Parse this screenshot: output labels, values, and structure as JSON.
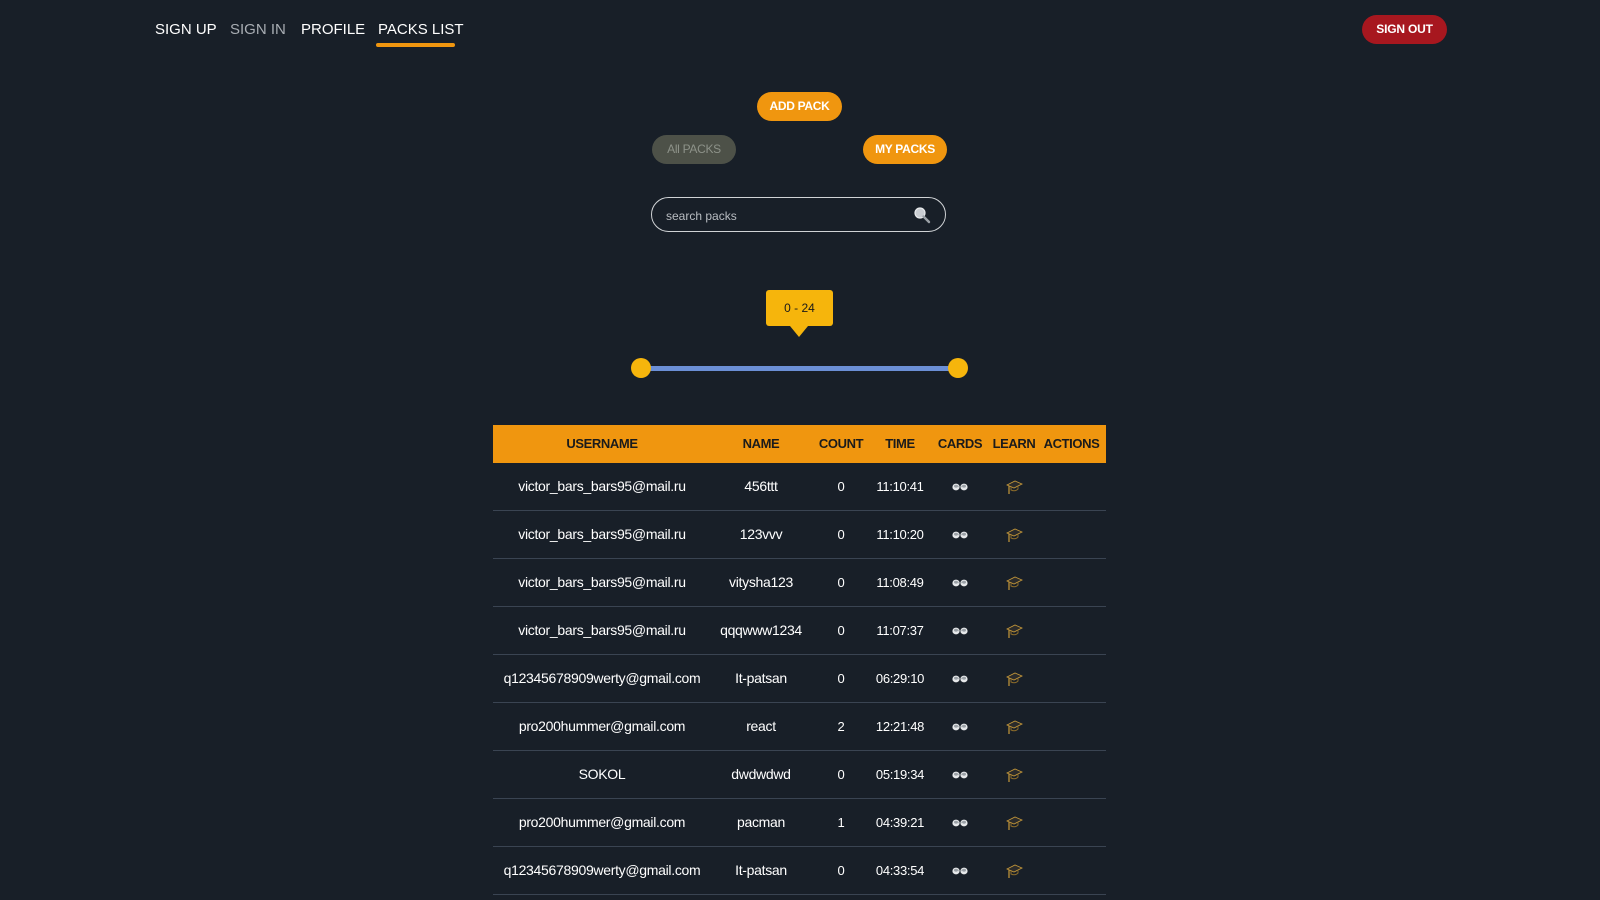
{
  "nav": {
    "links": [
      "SIGN UP",
      "SIGN IN",
      "PROFILE",
      "PACKS LIST"
    ],
    "active": "PACKS LIST",
    "signout_label": "SIGN OUT"
  },
  "controls": {
    "add_pack_label": "ADD PACK",
    "all_packs_label": "All PACKS",
    "my_packs_label": "MY PACKS",
    "search_placeholder": "search packs",
    "search_value": "",
    "range_label": "0 - 24",
    "range_min": 0,
    "range_max": 24
  },
  "table": {
    "headers": [
      "USERNAME",
      "NAME",
      "COUNT",
      "TIME",
      "CARDS",
      "LEARN",
      "ACTIONS"
    ],
    "rows": [
      {
        "username": "victor_bars_bars95@mail.ru",
        "name": "456ttt",
        "count": "0",
        "time": "11:10:41"
      },
      {
        "username": "victor_bars_bars95@mail.ru",
        "name": "123vvv",
        "count": "0",
        "time": "11:10:20"
      },
      {
        "username": "victor_bars_bars95@mail.ru",
        "name": "vitysha123",
        "count": "0",
        "time": "11:08:49"
      },
      {
        "username": "victor_bars_bars95@mail.ru",
        "name": "qqqwww1234",
        "count": "0",
        "time": "11:07:37"
      },
      {
        "username": "q12345678909werty@gmail.com",
        "name": "It-patsan",
        "count": "0",
        "time": "06:29:10"
      },
      {
        "username": "pro200hummer@gmail.com",
        "name": "react",
        "count": "2",
        "time": "12:21:48"
      },
      {
        "username": "SOKOL",
        "name": "dwdwdwd",
        "count": "0",
        "time": "05:19:34"
      },
      {
        "username": "pro200hummer@gmail.com",
        "name": "pacman",
        "count": "1",
        "time": "04:39:21"
      },
      {
        "username": "q12345678909werty@gmail.com",
        "name": "It-patsan",
        "count": "0",
        "time": "04:33:54"
      }
    ],
    "cards_icon": "eyeglasses-icon",
    "learn_icon": "graduation-cap-icon"
  },
  "colors": {
    "background": "#181f28",
    "accent": "#f0960f",
    "slider": "#f6b50c",
    "signout": "#a7171f"
  }
}
